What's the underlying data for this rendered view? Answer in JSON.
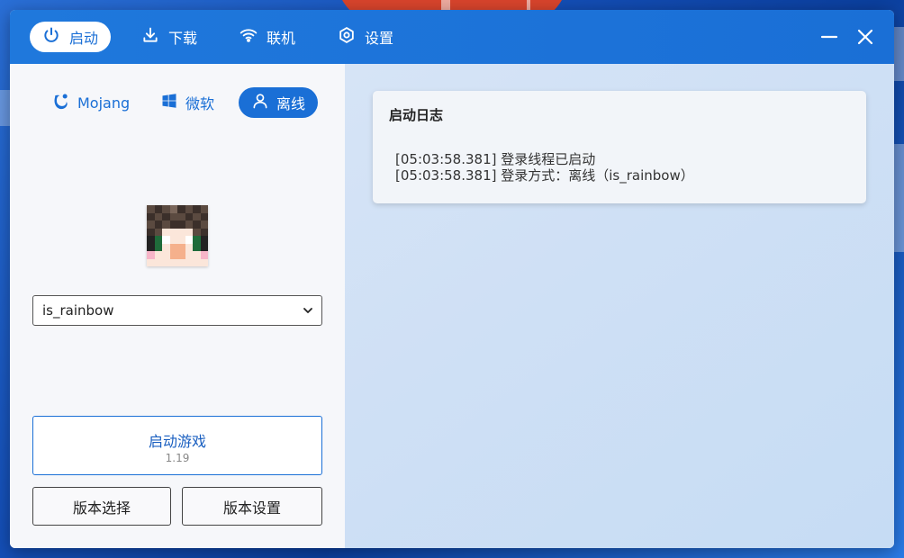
{
  "nav": {
    "items": [
      {
        "label": "启动",
        "icon": "power-icon",
        "active": true
      },
      {
        "label": "下载",
        "icon": "download-icon",
        "active": false
      },
      {
        "label": "联机",
        "icon": "wifi-icon",
        "active": false
      },
      {
        "label": "设置",
        "icon": "gear-icon",
        "active": false
      }
    ],
    "window_controls": [
      "minimize-icon",
      "close-icon"
    ]
  },
  "accounts": {
    "tabs": [
      {
        "label": "Mojang",
        "icon": "mojang-icon",
        "active": false
      },
      {
        "label": "微软",
        "icon": "windows-icon",
        "active": false
      },
      {
        "label": "离线",
        "icon": "user-icon",
        "active": true
      }
    ],
    "selected_user": "is_rainbow"
  },
  "launch": {
    "title": "启动游戏",
    "version": "1.19",
    "version_select": "版本选择",
    "version_settings": "版本设置"
  },
  "log": {
    "title": "启动日志",
    "lines": [
      "[05:03:58.381] 登录线程已启动",
      "[05:03:58.381] 登录方式：离线（is_rainbow）"
    ]
  },
  "colors": {
    "accent": "#1a6fd6",
    "titlebar": "#1f78dc",
    "panel": "#f6f7fa"
  }
}
